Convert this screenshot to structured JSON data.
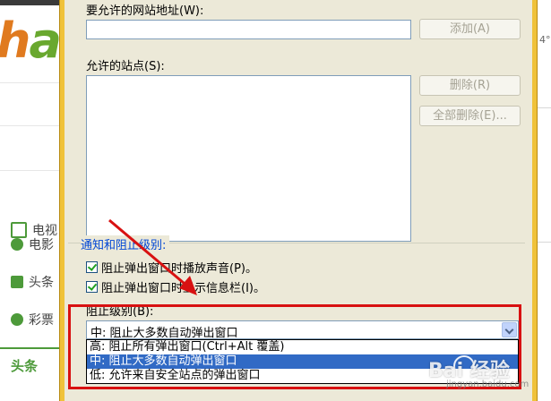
{
  "background": {
    "logo_part1": "h",
    "logo_part2": "a",
    "nav": [
      {
        "label": "电视",
        "icon": "tv-icon"
      },
      {
        "label": "电影",
        "icon": "film-icon"
      },
      {
        "label": "头条",
        "icon": "document-icon"
      },
      {
        "label": "彩票",
        "icon": "lottery-icon"
      }
    ],
    "toutiao_tab": "头条",
    "right_edge_text": "4°"
  },
  "dialog": {
    "address_label": "要允许的网站地址(W):",
    "address_value": "",
    "add_button": "添加(A)",
    "allowed_sites_label": "允许的站点(S):",
    "allowed_sites": [],
    "remove_button": "删除(R)",
    "remove_all_button": "全部删除(E)...",
    "notify_group_title": "通知和阻止级别:",
    "play_sound_checkbox": {
      "label": "阻止弹出窗口时播放声音(P)。",
      "checked": true
    },
    "show_infobar_checkbox": {
      "label": "阻止弹出窗口时显示信息栏(I)。",
      "checked": true
    },
    "block_level_label": "阻止级别(B):",
    "block_level_selected": "中: 阻止大多数自动弹出窗口",
    "block_level_options": [
      "高: 阻止所有弹出窗口(Ctrl+Alt 覆盖)",
      "中: 阻止大多数自动弹出窗口",
      "低: 允许来自安全站点的弹出窗口"
    ],
    "highlighted_option_index": 1
  },
  "watermark": {
    "brand": "Bai 经验",
    "url": "jingyan.baidu.com"
  },
  "colors": {
    "dialog_bg": "#ece9d8",
    "frame": "#f0c23a",
    "highlight": "#316ac5",
    "annotation_red": "#d81111",
    "group_title": "#0046d5"
  }
}
